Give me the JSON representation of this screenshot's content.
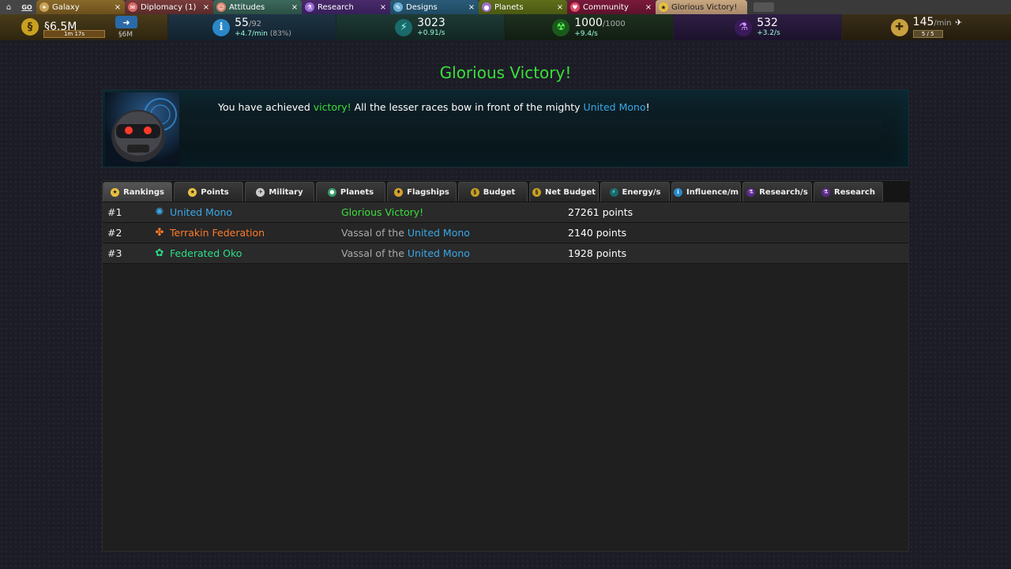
{
  "tabs": [
    {
      "label": "Galaxy",
      "icon": "galaxy-icon"
    },
    {
      "label": "Diplomacy (1)",
      "icon": "diplomacy-icon"
    },
    {
      "label": "Attitudes",
      "icon": "attitudes-icon"
    },
    {
      "label": "Research",
      "icon": "research-icon"
    },
    {
      "label": "Designs",
      "icon": "designs-icon"
    },
    {
      "label": "Planets",
      "icon": "planets-icon"
    },
    {
      "label": "Community",
      "icon": "community-icon"
    },
    {
      "label": "Glorious Victory!",
      "icon": "medal-icon"
    }
  ],
  "go_label": "GO",
  "close_glyph": "×",
  "resources": {
    "money": {
      "value": "§6.5M",
      "timer": "1m 17s",
      "debt": "§6M"
    },
    "influence": {
      "value": "55",
      "max": "/92",
      "rate": "+4.7/min",
      "pct": " (83%)"
    },
    "energy": {
      "value": "3023",
      "rate": "+0.91/s"
    },
    "defense": {
      "value": "1000",
      "max": "/1000",
      "rate": "+9.4/s"
    },
    "research": {
      "value": "532",
      "rate": "+3.2/s"
    },
    "ftl": {
      "value": "145",
      "unit": "/min",
      "bar": "5 / 5"
    }
  },
  "title": "Glorious Victory!",
  "message": {
    "part1": "You have achieved ",
    "highlight1": "victory!",
    "part2": " All the lesser races bow in front of the mighty ",
    "highlight2": "United Mono",
    "part3": "!"
  },
  "ranking_tabs": [
    {
      "label": "Rankings",
      "icon": "medal-icon",
      "active": true
    },
    {
      "label": "Points",
      "icon": "medal-icon"
    },
    {
      "label": "Military",
      "icon": "military-icon"
    },
    {
      "label": "Planets",
      "icon": "planet-icon"
    },
    {
      "label": "Flagships",
      "icon": "flagship-icon"
    },
    {
      "label": "Budget",
      "icon": "money-icon"
    },
    {
      "label": "Net Budget",
      "icon": "money-icon"
    },
    {
      "label": "Energy/s",
      "icon": "energy-icon"
    },
    {
      "label": "Influence/m",
      "icon": "influence-icon"
    },
    {
      "label": "Research/s",
      "icon": "research-icon"
    },
    {
      "label": "Research",
      "icon": "research-icon"
    }
  ],
  "rankings": [
    {
      "rank": "#1",
      "empire": "United Mono",
      "status_text": "Glorious Victory!",
      "status_link": "",
      "points": "27261 points",
      "color": "#3aa8e8"
    },
    {
      "rank": "#2",
      "empire": "Terrakin Federation",
      "status_text": "Vassal of the ",
      "status_link": "United Mono",
      "points": "2140 points",
      "color": "#ff7a2a"
    },
    {
      "rank": "#3",
      "empire": "Federated Oko",
      "status_text": "Vassal of the ",
      "status_link": "United Mono",
      "points": "1928 points",
      "color": "#2adf8a"
    }
  ]
}
